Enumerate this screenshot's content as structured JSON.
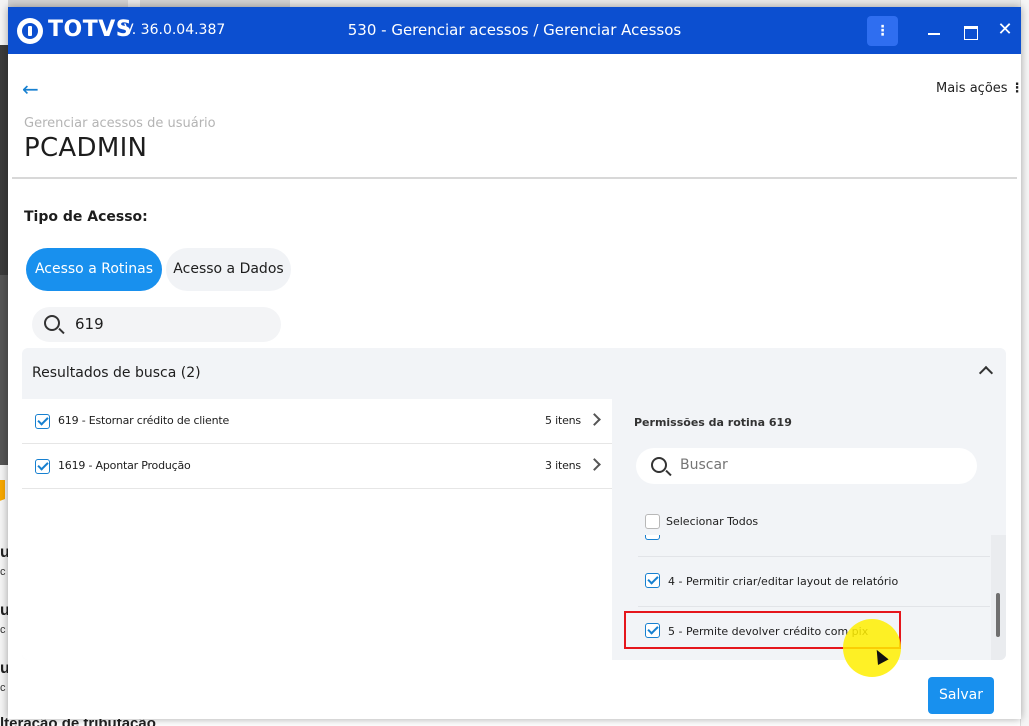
{
  "window": {
    "brand": "TOTVS",
    "version": "V. 36.0.04.387",
    "title": "530 - Gerenciar acessos / Gerenciar Acessos",
    "kebab_glyph": "⋮",
    "close_glyph": "✕"
  },
  "background": {
    "letters": [
      "u",
      "u",
      "u"
    ],
    "subletters": [
      "c",
      "c",
      "c"
    ],
    "bottom_text": "lteração de tributação"
  },
  "page": {
    "back_glyph": "←",
    "more_actions": "Mais ações",
    "more_actions_glyph": "⋮",
    "breadcrumb": "Gerenciar acessos de usuário",
    "user": "PCADMIN"
  },
  "access": {
    "label": "Tipo de Acesso:",
    "tabs": [
      {
        "label": "Acesso a Rotinas",
        "active": true
      },
      {
        "label": "Acesso a Dados",
        "active": false
      }
    ]
  },
  "search": {
    "value": "619"
  },
  "results": {
    "title": "Resultados de busca (2)",
    "rows": [
      {
        "label": "619 - Estornar crédito de cliente",
        "count": "5 itens",
        "checked": true
      },
      {
        "label": "1619 - Apontar Produção",
        "count": "3 itens",
        "checked": true
      }
    ]
  },
  "permissions": {
    "title": "Permissões da rotina 619",
    "search_placeholder": "Buscar",
    "select_all": "Selecionar Todos",
    "items": [
      {
        "label": "4 - Permitir criar/editar layout de relatório",
        "checked": true
      },
      {
        "label": "5 - Permite devolver crédito com pix",
        "checked": true
      }
    ]
  },
  "footer": {
    "save": "Salvar"
  },
  "colors": {
    "titlebar": "#0c4fd0",
    "accent": "#1890ee",
    "highlight": "#e5161c",
    "cursor_halo": "#ffee00"
  }
}
